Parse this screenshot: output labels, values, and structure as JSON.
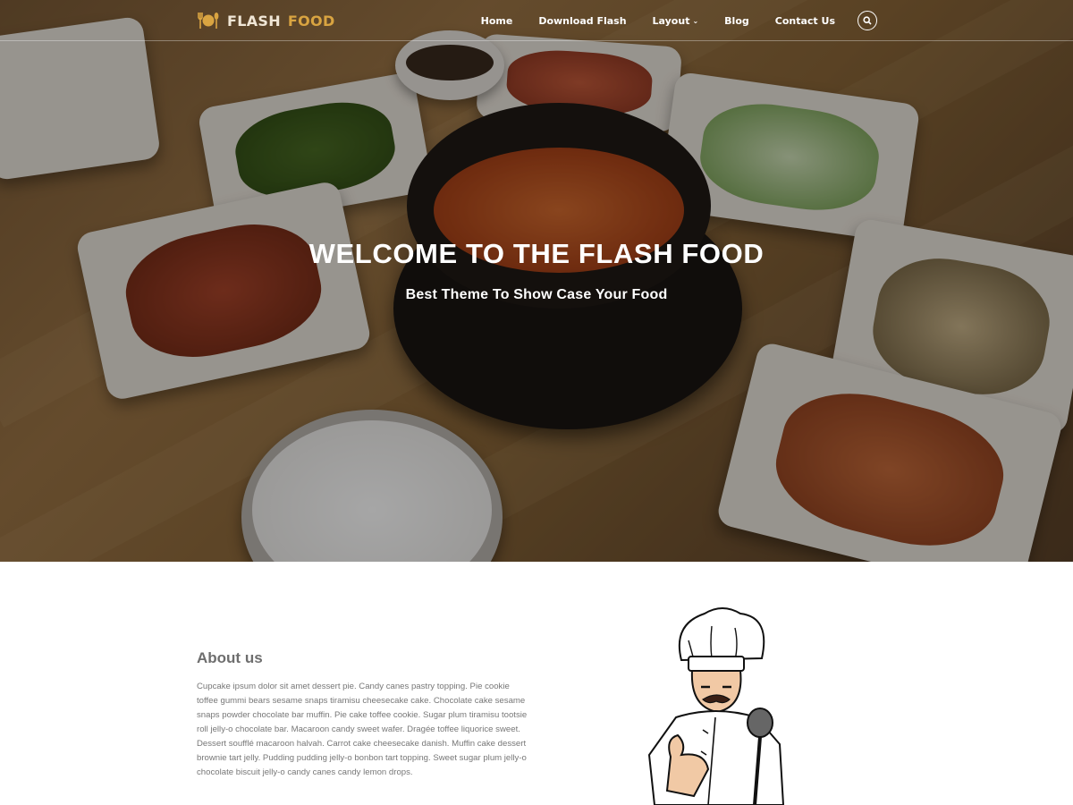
{
  "brand": {
    "part1": "FLASH",
    "part2": "FOOD"
  },
  "nav": {
    "items": [
      {
        "label": "Home"
      },
      {
        "label": "Download Flash"
      },
      {
        "label": "Layout"
      },
      {
        "label": "Blog"
      },
      {
        "label": "Contact Us"
      }
    ]
  },
  "hero": {
    "title": "WELCOME TO THE FLASH FOOD",
    "subtitle": "Best Theme To Show Case Your Food"
  },
  "about": {
    "title": "About us",
    "text": "Cupcake ipsum dolor sit amet dessert pie. Candy canes pastry topping. Pie cookie toffee gummi bears sesame snaps tiramisu cheesecake cake. Chocolate cake sesame snaps powder chocolate bar muffin. Pie cake toffee cookie. Sugar plum tiramisu tootsie roll jelly-o chocolate bar. Macaroon candy sweet wafer. Dragée toffee liquorice sweet. Dessert soufflé macaroon halvah. Carrot cake cheesecake danish. Muffin cake dessert brownie tart jelly. Pudding pudding jelly-o bonbon tart topping. Sweet sugar plum jelly-o chocolate biscuit jelly-o candy canes candy lemon drops."
  },
  "colors": {
    "accent": "#d9a441",
    "text_muted": "#777777",
    "heading": "#6e6e6e"
  },
  "icons": {
    "logo": "fork-plate-spoon-icon",
    "search": "search-icon",
    "dropdown": "chevron-down-icon",
    "chef": "chef-illustration"
  }
}
